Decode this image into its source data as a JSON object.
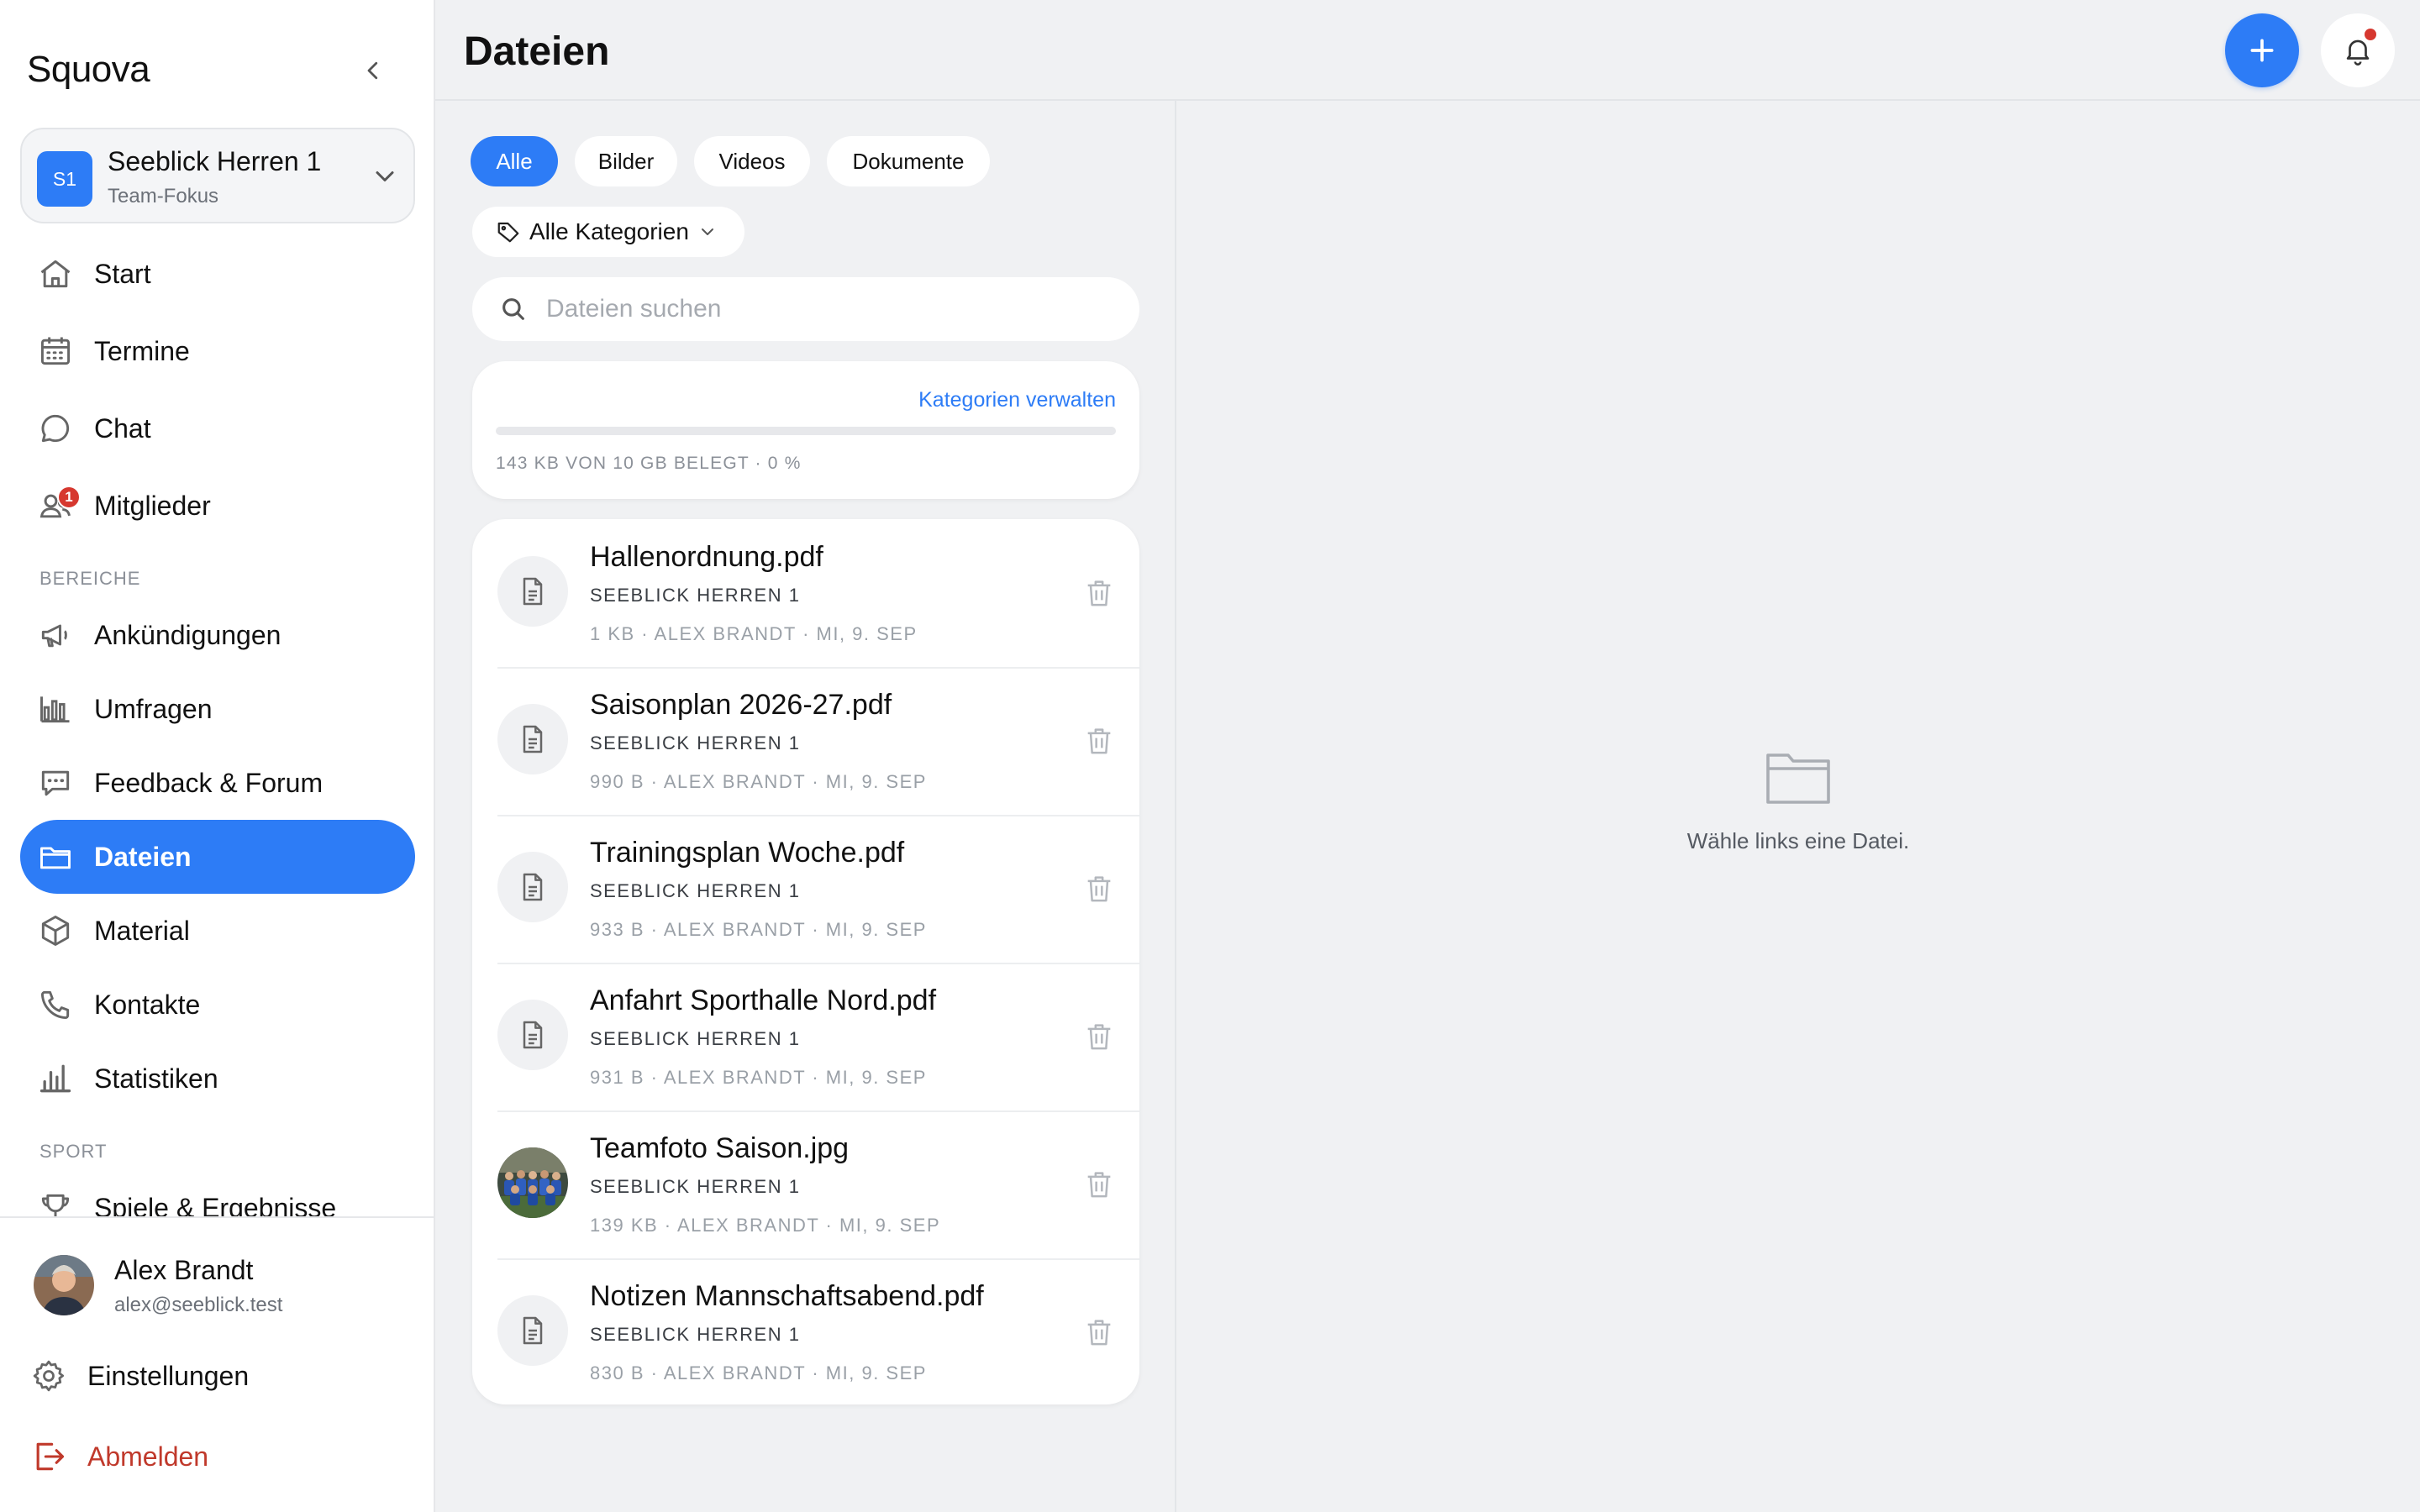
{
  "app": {
    "name": "Squova"
  },
  "team": {
    "badge": "S1",
    "name": "Seeblick Herren 1",
    "subtitle": "Team-Fokus"
  },
  "nav": {
    "main": [
      {
        "label": "Start",
        "icon": "home-icon"
      },
      {
        "label": "Termine",
        "icon": "calendar-icon"
      },
      {
        "label": "Chat",
        "icon": "chat-bubble-icon"
      },
      {
        "label": "Mitglieder",
        "icon": "members-icon",
        "badge": "1"
      }
    ],
    "bereiche_label": "BEREICHE",
    "bereiche": [
      {
        "label": "Ankündigungen",
        "icon": "megaphone-icon"
      },
      {
        "label": "Umfragen",
        "icon": "bar-chart-icon"
      },
      {
        "label": "Feedback & Forum",
        "icon": "forum-icon"
      },
      {
        "label": "Dateien",
        "icon": "folder-icon",
        "active": true
      },
      {
        "label": "Material",
        "icon": "box-icon"
      },
      {
        "label": "Kontakte",
        "icon": "phone-icon"
      },
      {
        "label": "Statistiken",
        "icon": "stats-icon"
      }
    ],
    "sport_label": "SPORT",
    "sport": [
      {
        "label": "Spiele & Ergebnisse",
        "icon": "trophy-icon"
      }
    ]
  },
  "user": {
    "name": "Alex Brandt",
    "email": "alex@seeblick.test"
  },
  "footer": {
    "settings_label": "Einstellungen",
    "logout_label": "Abmelden"
  },
  "header": {
    "title": "Dateien"
  },
  "filters": {
    "tabs": [
      {
        "label": "Alle",
        "active": true
      },
      {
        "label": "Bilder"
      },
      {
        "label": "Videos"
      },
      {
        "label": "Dokumente"
      }
    ],
    "category": "Alle Kategorien"
  },
  "search": {
    "placeholder": "Dateien suchen",
    "value": ""
  },
  "storage": {
    "manage_label": "Kategorien verwalten",
    "text": "143 KB VON 10 GB BELEGT · 0 %",
    "fraction": 0.0
  },
  "files": [
    {
      "name": "Hallenordnung.pdf",
      "team": "SEEBLICK HERREN 1",
      "meta": "1 KB · ALEX BRANDT · MI, 9. SEP",
      "type": "document"
    },
    {
      "name": "Saisonplan 2026-27.pdf",
      "team": "SEEBLICK HERREN 1",
      "meta": "990 B · ALEX BRANDT · MI, 9. SEP",
      "type": "document"
    },
    {
      "name": "Trainingsplan Woche.pdf",
      "team": "SEEBLICK HERREN 1",
      "meta": "933 B · ALEX BRANDT · MI, 9. SEP",
      "type": "document"
    },
    {
      "name": "Anfahrt Sporthalle Nord.pdf",
      "team": "SEEBLICK HERREN 1",
      "meta": "931 B · ALEX BRANDT · MI, 9. SEP",
      "type": "document"
    },
    {
      "name": "Teamfoto Saison.jpg",
      "team": "SEEBLICK HERREN 1",
      "meta": "139 KB · ALEX BRANDT · MI, 9. SEP",
      "type": "image"
    },
    {
      "name": "Notizen Mannschaftsabend.pdf",
      "team": "SEEBLICK HERREN 1",
      "meta": "830 B · ALEX BRANDT · MI, 9. SEP",
      "type": "document"
    }
  ],
  "preview": {
    "empty_text": "Wähle links eine Datei."
  },
  "colors": {
    "accent": "#2d7cf6",
    "danger": "#d6382f",
    "logout": "#c0392b"
  }
}
